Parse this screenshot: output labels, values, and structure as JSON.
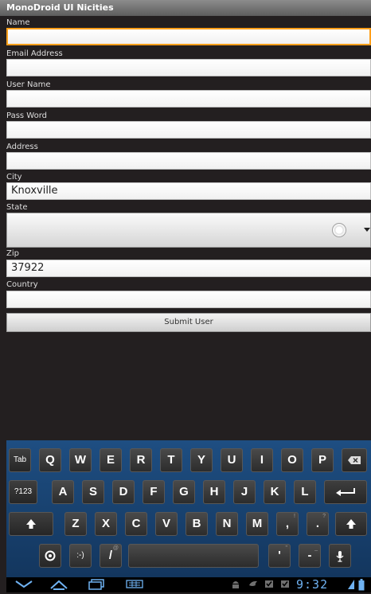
{
  "app": {
    "title": "MonoDroid UI Nicities"
  },
  "form": {
    "name": {
      "label": "Name",
      "value": ""
    },
    "email": {
      "label": "Email Address",
      "value": ""
    },
    "username": {
      "label": "User Name",
      "value": ""
    },
    "password": {
      "label": "Pass Word",
      "value": ""
    },
    "address": {
      "label": "Address",
      "value": ""
    },
    "city": {
      "label": "City",
      "value": "Knoxville"
    },
    "state": {
      "label": "State",
      "value": ""
    },
    "zip": {
      "label": "Zip",
      "value": "37922"
    },
    "country": {
      "label": "Country",
      "value": ""
    },
    "submit_label": "Submit User"
  },
  "keyboard": {
    "row1": [
      "Tab",
      "Q",
      "W",
      "E",
      "R",
      "T",
      "Y",
      "U",
      "I",
      "O",
      "P"
    ],
    "row2": [
      "?123",
      "A",
      "S",
      "D",
      "F",
      "G",
      "H",
      "J",
      "K",
      "L"
    ],
    "row3": [
      "Z",
      "X",
      "C",
      "V",
      "B",
      "N",
      "M",
      ",",
      "."
    ],
    "row3_hints": [
      "!",
      "?"
    ],
    "row4": [
      ":-)",
      "/",
      "'",
      "-"
    ],
    "row4_hints": [
      "@",
      "\"",
      "_"
    ],
    "icons": {
      "backspace": "backspace-icon",
      "enter": "enter-icon",
      "shift": "shift-icon",
      "settings": "settings-icon",
      "mic": "mic-icon",
      "space": "spacebar"
    }
  },
  "statusbar": {
    "time": "9:32",
    "nav_icons": [
      "back-icon",
      "home-icon",
      "recent-apps-icon",
      "keyboard-switch-icon"
    ],
    "status_icons": [
      "android-debug-icon",
      "bird-icon",
      "checkbox-icon",
      "checkbox-icon",
      "battery-icon",
      "signal-icon"
    ],
    "accent_color": "#6fb2f2"
  }
}
